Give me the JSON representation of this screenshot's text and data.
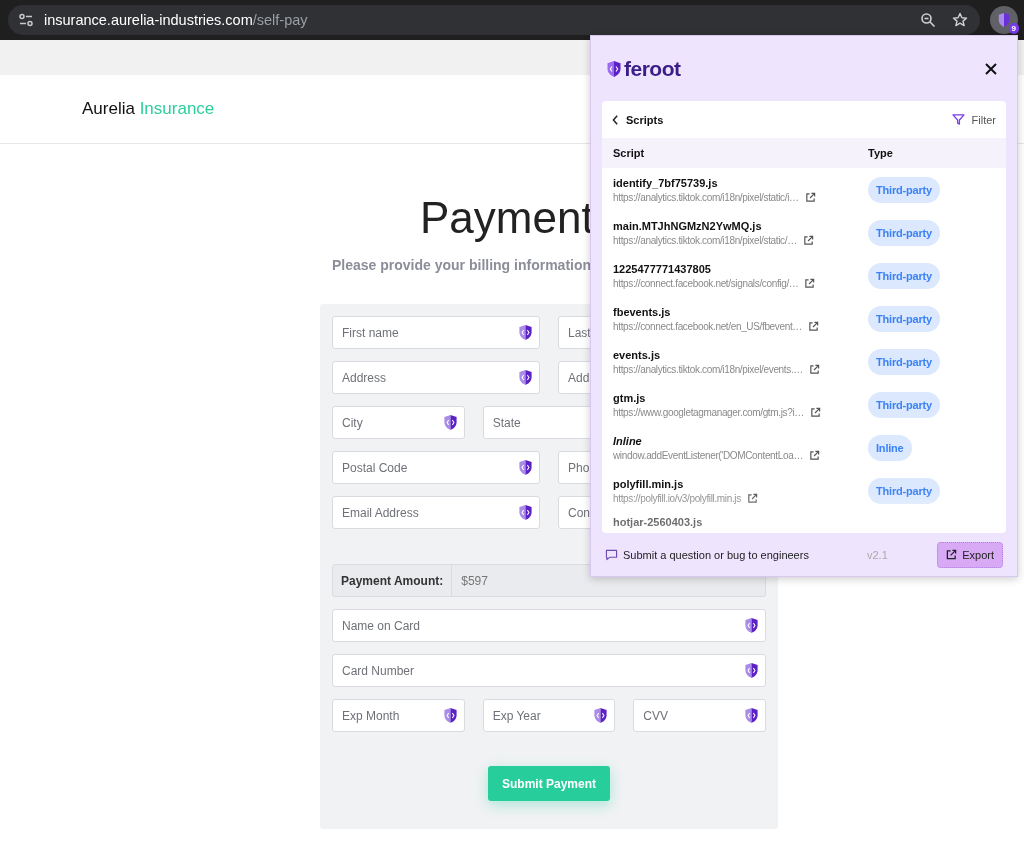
{
  "browser": {
    "url_host": "insurance.aurelia-industries.com",
    "url_path": "/self-pay",
    "extension_badge": "9"
  },
  "site": {
    "brand_name": "Aurelia",
    "brand_accent": "Insurance"
  },
  "page": {
    "title": "Payment",
    "subtitle": "Please provide your billing information"
  },
  "form": {
    "rows": [
      {
        "kind": "pair",
        "fields": [
          {
            "placeholder": "First name",
            "protected": true
          },
          {
            "placeholder": "Last"
          }
        ]
      },
      {
        "kind": "pair",
        "fields": [
          {
            "placeholder": "Address",
            "protected": true
          },
          {
            "placeholder": "Add"
          }
        ]
      },
      {
        "kind": "triple",
        "fields": [
          {
            "placeholder": "City",
            "protected": true
          },
          {
            "placeholder": "State"
          }
        ]
      },
      {
        "kind": "pair",
        "fields": [
          {
            "placeholder": "Postal Code",
            "protected": true
          },
          {
            "placeholder": "Pho"
          }
        ]
      },
      {
        "kind": "pair",
        "fields": [
          {
            "placeholder": "Email Address",
            "protected": true
          },
          {
            "placeholder": "Con"
          }
        ]
      }
    ],
    "amount": {
      "label": "Payment Amount:",
      "value": "$597"
    },
    "card_rows": [
      {
        "kind": "full",
        "fields": [
          {
            "placeholder": "Name on Card",
            "protected": true
          }
        ]
      },
      {
        "kind": "full",
        "fields": [
          {
            "placeholder": "Card Number",
            "protected": true
          }
        ]
      },
      {
        "kind": "triple",
        "fields": [
          {
            "placeholder": "Exp Month",
            "protected": true
          },
          {
            "placeholder": "Exp Year",
            "protected": true
          },
          {
            "placeholder": "CVV",
            "protected": true
          }
        ]
      }
    ],
    "submit": "Submit Payment"
  },
  "popup": {
    "logo_text": "feroot",
    "back_label": "Scripts",
    "filter_label": "Filter",
    "columns": [
      "Script",
      "Type"
    ],
    "rows": [
      {
        "kind": "file",
        "name": "identify_7bf75739.js",
        "url": "https://analytics.tiktok.com/i18n/pixel/static/i…",
        "type": "Third-party"
      },
      {
        "kind": "file",
        "name": "main.MTJhNGMzN2YwMQ.js",
        "url": "https://analytics.tiktok.com/i18n/pixel/static/…",
        "type": "Third-party"
      },
      {
        "kind": "file",
        "name": "1225477771437805",
        "url": "https://connect.facebook.net/signals/config/…",
        "type": "Third-party"
      },
      {
        "kind": "file",
        "name": "fbevents.js",
        "url": "https://connect.facebook.net/en_US/fbevent…",
        "type": "Third-party"
      },
      {
        "kind": "file",
        "name": "events.js",
        "url": "https://analytics.tiktok.com/i18n/pixel/events.…",
        "type": "Third-party"
      },
      {
        "kind": "file",
        "name": "gtm.js",
        "url": "https://www.googletagmanager.com/gtm.js?i…",
        "type": "Third-party"
      },
      {
        "kind": "inline",
        "name": "Inline",
        "url": "window.addEventListener('DOMContentLoa…",
        "type": "Inline"
      },
      {
        "kind": "file",
        "name": "polyfill.min.js",
        "url": "https://polyfill.io/v3/polyfill.min.js",
        "type": "Third-party"
      },
      {
        "kind": "file",
        "name": "hotjar-2560403.js"
      }
    ],
    "feedback_link": "Submit a question or bug to engineers",
    "version": "v2.1",
    "export_label": "Export"
  }
}
